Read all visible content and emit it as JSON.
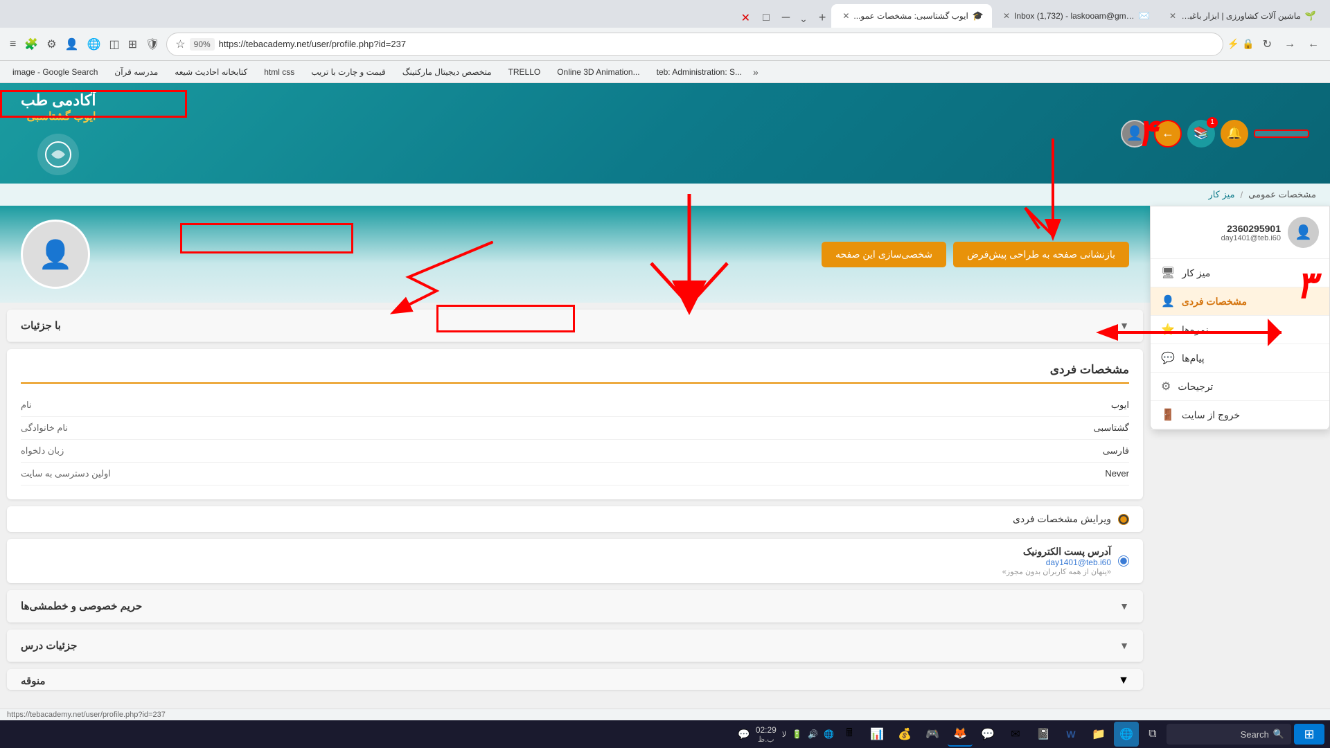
{
  "browser": {
    "tabs": [
      {
        "id": 1,
        "label": "ماشین آلات کشاورزی | ابزار باغبا...",
        "favicon": "🌱",
        "active": false
      },
      {
        "id": 2,
        "label": "Inbox (1,732) - laskooam@gma...",
        "favicon": "✉️",
        "active": false
      },
      {
        "id": 3,
        "label": "ایوب گشتاسبی: مشخصات عمو...",
        "favicon": "🎓",
        "active": true
      }
    ],
    "url": "https://tebacademy.net/user/profile.php?id=237",
    "zoom": "90%",
    "new_tab_label": "+",
    "overflow_label": "⌄"
  },
  "bookmarks": [
    {
      "label": "image - Google Search"
    },
    {
      "label": "مدرسه قرآن"
    },
    {
      "label": "کتابخانه احادیث شیعه"
    },
    {
      "label": "html css"
    },
    {
      "label": "قیمت و چارت با تریب"
    },
    {
      "label": "متخصص دیجیتال مارکتینگ"
    },
    {
      "label": "TRELLO"
    },
    {
      "label": "Online 3D Animation..."
    },
    {
      "label": "teb: Administration: S..."
    }
  ],
  "header": {
    "site_name": "آکادمی طب",
    "user_name": "ایوب گشتاسبی",
    "subtitle": ""
  },
  "breadcrumb": {
    "home": "میز کار",
    "separator": "/",
    "current": "مشخصات عمومی"
  },
  "user_dropdown": {
    "user_id": "2360295901",
    "email": "day1401@teb.i60",
    "menu_items": [
      {
        "label": "میز کار",
        "icon": "🖥"
      },
      {
        "label": "مشخصات فردی",
        "icon": "👤",
        "active": true
      },
      {
        "label": "نمره‌ها",
        "icon": "⭐"
      },
      {
        "label": "پیام‌ها",
        "icon": "💬"
      },
      {
        "label": "ترجیحات",
        "icon": "⚙"
      },
      {
        "label": "خروج از سایت",
        "icon": "🚪"
      }
    ]
  },
  "profile": {
    "actions": [
      {
        "label": "بازنشانی صفحه به طراحی پیش‌فرض"
      },
      {
        "label": "شخصی‌سازی این صفحه"
      }
    ]
  },
  "sections": {
    "with_details_label": "با جزئیات",
    "personal_info": {
      "title": "مشخصات فردی",
      "fields": [
        {
          "label": "نام",
          "value": "ایوب"
        },
        {
          "label": "نام خانوادگی",
          "value": "گشتاسبی"
        },
        {
          "label": "زبان دلخواه",
          "value": "فارسی"
        },
        {
          "label": "اولین دسترسی به سایت",
          "value": "Never"
        }
      ]
    },
    "edit_profile": {
      "label": "ویرایش مشخصات فردی"
    },
    "email": {
      "label": "آدرس پست الکترونیک",
      "value": "day1401@teb.i60",
      "note": "«پنهان از همه کاربران بدون مجوز»"
    },
    "privacy": {
      "label": "حریم خصوصی و خطمشی‌ها"
    },
    "course_details": {
      "label": "جزئیات درس"
    },
    "category": {
      "label": "منوقه"
    }
  },
  "taskbar": {
    "search_placeholder": "Search",
    "time": "02:29",
    "date": "ب.ظ",
    "apps": [
      "⊞",
      "🔍",
      "📋",
      "🌐",
      "W",
      "📁",
      "📓",
      "✉",
      "📞",
      "🎵",
      "🦊",
      "🎯",
      "💰",
      "📊",
      "🖩"
    ]
  },
  "annotations": {
    "number_3": "۳",
    "number_4": "۴"
  }
}
